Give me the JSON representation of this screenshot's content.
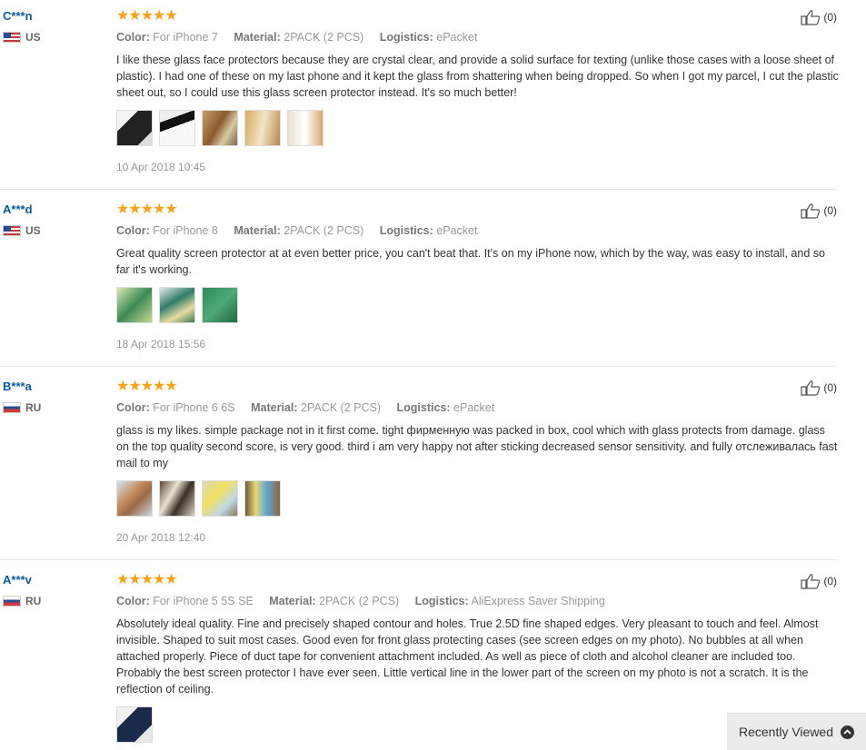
{
  "reviews": [
    {
      "user": "C***n",
      "country": "US",
      "stars": "★★★★★",
      "labels": {
        "color": "Color:",
        "material": "Material:",
        "logistics": "Logistics:"
      },
      "color": "For iPhone 7",
      "material": "2PACK (2 PCS)",
      "logistics": "ePacket",
      "text": "I like these glass face protectors because they are crystal clear, and provide a solid surface for texting (unlike those cases with a loose sheet of plastic). I had one of these on my last phone and it kept the glass from shattering when being dropped. So when I got my parcel, I cut the plastic sheet out, so I could use this glass screen protector instead. It's so much better!",
      "date": "10 Apr 2018 10:45",
      "likes": "(0)"
    },
    {
      "user": "A***d",
      "country": "US",
      "stars": "★★★★★",
      "labels": {
        "color": "Color:",
        "material": "Material:",
        "logistics": "Logistics:"
      },
      "color": "For iPhone 8",
      "material": "2PACK (2 PCS)",
      "logistics": "ePacket",
      "text": "Great quality screen protector at at even better price, you can't beat that. It's on my iPhone now, which by the way, was easy to install, and so far it's working.",
      "date": "18 Apr 2018 15:56",
      "likes": "(0)"
    },
    {
      "user": "B***a",
      "country": "RU",
      "stars": "★★★★★",
      "labels": {
        "color": "Color:",
        "material": "Material:",
        "logistics": "Logistics:"
      },
      "color": "For iPhone 6 6S",
      "material": "2PACK (2 PCS)",
      "logistics": "ePacket",
      "text": "glass is my likes. simple package not in it first come. tight фирменную was packed in box, cool which with glass protects from damage. glass on the top quality second score, is very good. third i am very happy not after sticking decreased sensor sensitivity. and fully отслеживалась fast mail to my",
      "date": "20 Apr 2018 12:40",
      "likes": "(0)"
    },
    {
      "user": "A***v",
      "country": "RU",
      "stars": "★★★★★",
      "labels": {
        "color": "Color:",
        "material": "Material:",
        "logistics": "Logistics:"
      },
      "color": "For iPhone 5 5S SE",
      "material": "2PACK (2 PCS)",
      "logistics": "AliExpress Saver Shipping",
      "text": "Absolutely ideal quality. Fine and precisely shaped contour and holes. True 2.5D fine shaped edges. Very pleasant to touch and feel. Almost invisible. Shaped to suit most cases. Good even for front glass protecting cases (see screen edges on my photo). No bubbles at all when attached properly. Piece of duct tape for convenient attachment included. As well as piece of cloth and alcohol cleaner are included too. Probably the best screen protector I have ever seen. Little vertical line in the lower part of the screen on my photo is not a scratch. It is the reflection of ceiling.",
      "date": "",
      "likes": "(0)"
    }
  ],
  "recently_viewed": {
    "label": "Recently Viewed"
  },
  "colors": {
    "user": "#0a5a9c",
    "stars": "#f7a21b",
    "meta": "#999999"
  }
}
